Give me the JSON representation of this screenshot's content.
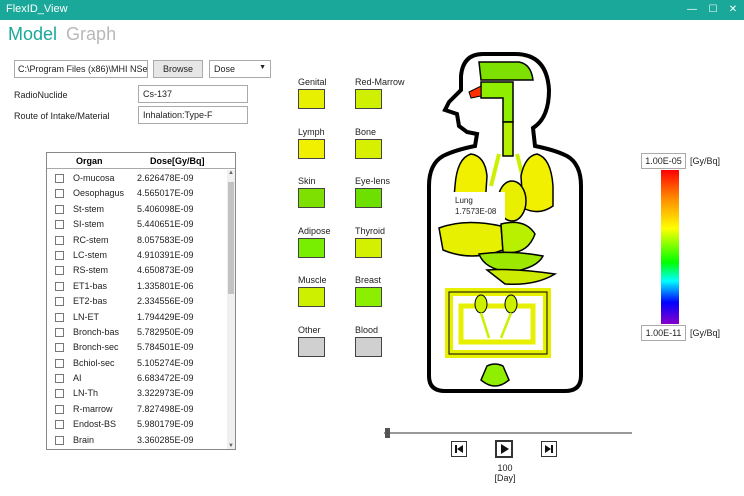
{
  "window": {
    "title": "FlexID_View",
    "min": "—",
    "max": "☐",
    "close": "✕"
  },
  "tabs": {
    "model": "Model",
    "graph": "Graph"
  },
  "toolbar": {
    "path": "C:\\Program Files (x86)\\MHI NSeng",
    "browse_label": "Browse",
    "mode_selected": "Dose"
  },
  "form": {
    "radionuclide_label": "RadioNuclide",
    "radionuclide_value": "Cs-137",
    "route_label": "Route of Intake/Material",
    "route_value": "Inhalation:Type-F"
  },
  "table": {
    "headers": {
      "organ": "Organ",
      "dose": "Dose[Gy/Bq]"
    },
    "rows": [
      {
        "organ": "O-mucosa",
        "dose": "2.626478E-09"
      },
      {
        "organ": "Oesophagus",
        "dose": "4.565017E-09"
      },
      {
        "organ": "St-stem",
        "dose": "5.406098E-09"
      },
      {
        "organ": "SI-stem",
        "dose": "5.440651E-09"
      },
      {
        "organ": "RC-stem",
        "dose": "8.057583E-09"
      },
      {
        "organ": "LC-stem",
        "dose": "4.910391E-09"
      },
      {
        "organ": "RS-stem",
        "dose": "4.650873E-09"
      },
      {
        "organ": "ET1-bas",
        "dose": "1.335801E-06"
      },
      {
        "organ": "ET2-bas",
        "dose": "2.334556E-09"
      },
      {
        "organ": "LN-ET",
        "dose": "1.794429E-09"
      },
      {
        "organ": "Bronch-bas",
        "dose": "5.782950E-09"
      },
      {
        "organ": "Bronch-sec",
        "dose": "5.784501E-09"
      },
      {
        "organ": "Bchiol-sec",
        "dose": "5.105274E-09"
      },
      {
        "organ": "AI",
        "dose": "6.683472E-09"
      },
      {
        "organ": "LN-Th",
        "dose": "3.322973E-09"
      },
      {
        "organ": "R-marrow",
        "dose": "7.827498E-09"
      },
      {
        "organ": "Endost-BS",
        "dose": "5.980179E-09"
      },
      {
        "organ": "Brain",
        "dose": "3.360285E-09"
      }
    ]
  },
  "legend": {
    "genital": "Genital",
    "red_marrow": "Red-Marrow",
    "lymph": "Lymph",
    "bone": "Bone",
    "skin": "Skin",
    "eye_lens": "Eye-lens",
    "adipose": "Adipose",
    "thyroid": "Thyroid",
    "muscle": "Muscle",
    "breast": "Breast",
    "other": "Other",
    "blood": "Blood"
  },
  "colors": {
    "genital": "#e6f000",
    "red_marrow": "#cff000",
    "lymph": "#f0f000",
    "bone": "#d6f000",
    "skin": "#7ee000",
    "eye_lens": "#6ee000",
    "adipose": "#78ee00",
    "thyroid": "#d2f000",
    "muscle": "#ccf000",
    "breast": "#8cee00",
    "other": "#d0d0d0",
    "blood": "#d0d0d0",
    "accent": "#1aa89a"
  },
  "tooltip": {
    "organ": "Lung",
    "value": "1.7573E-08"
  },
  "colorbar": {
    "max": "1.00E-05",
    "min": "1.00E-11",
    "unit": "[Gy/Bq]"
  },
  "playback": {
    "day": "100",
    "unit": "[Day]"
  }
}
